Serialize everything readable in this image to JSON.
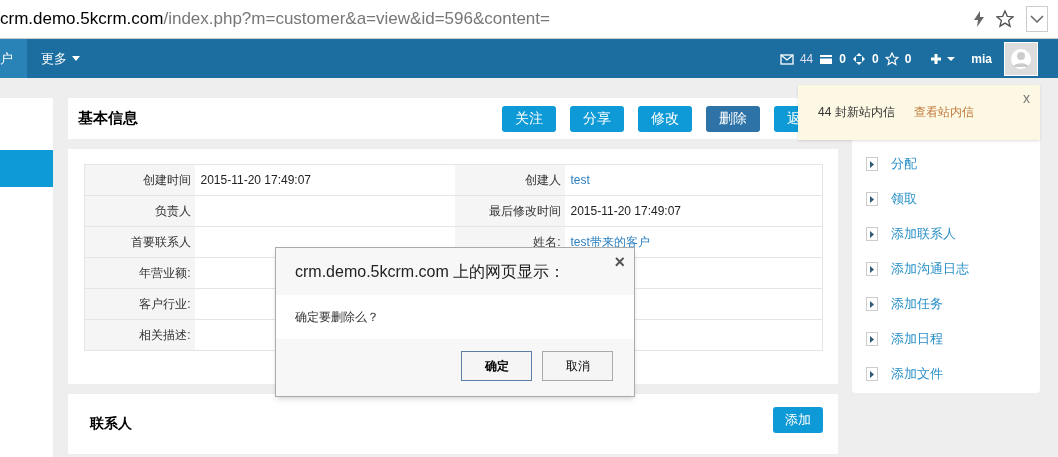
{
  "address_bar": {
    "host": "crm.demo.5kcrm.com",
    "path": "/index.php?m=customer&a=view&id=596&content="
  },
  "navbar": {
    "items": [
      {
        "label": "户",
        "selected": true
      },
      {
        "label": "更多",
        "selected": false
      }
    ],
    "counters": [
      {
        "kind": "mail",
        "value": "44"
      },
      {
        "kind": "card",
        "value": "0"
      },
      {
        "kind": "move",
        "value": "0"
      },
      {
        "kind": "star",
        "value": "0"
      }
    ],
    "user": "mia"
  },
  "basic_info": {
    "title": "基本信息",
    "buttons": [
      {
        "label": "关注",
        "kind": "primary"
      },
      {
        "label": "分享",
        "kind": "primary"
      },
      {
        "label": "修改",
        "kind": "primary"
      },
      {
        "label": "删除",
        "kind": "danger"
      },
      {
        "label": "返",
        "kind": "primary"
      }
    ],
    "rows": [
      {
        "cells": [
          {
            "label": "创建时间",
            "value": "2015-11-20 17:49:07",
            "kind": "text"
          },
          {
            "label": "创建人",
            "value": "test",
            "kind": "link"
          }
        ]
      },
      {
        "cells": [
          {
            "label": "负责人"
          },
          {
            "label": "最后修改时间",
            "value": "2015-11-20 17:49:07",
            "kind": "text"
          }
        ]
      },
      {
        "cells": [
          {
            "label": "首要联系人"
          },
          {
            "label": "姓名:",
            "value": "test带来的客户",
            "kind": "link"
          }
        ]
      },
      {
        "cells": [
          {
            "label": "年营业额:"
          },
          {}
        ]
      },
      {
        "cells": [
          {
            "label": "客户行业:"
          },
          {}
        ]
      },
      {
        "cells": [
          {
            "label": "相关描述:"
          },
          {}
        ]
      }
    ]
  },
  "contacts": {
    "title": "联系人",
    "add_button": "添加"
  },
  "actions": [
    "分配",
    "领取",
    "添加联系人",
    "添加沟通日志",
    "添加任务",
    "添加日程",
    "添加文件"
  ],
  "notification": {
    "text": "44 封新站内信",
    "link": "查看站内信",
    "close": "x"
  },
  "dialog": {
    "title": "crm.demo.5kcrm.com 上的网页显示：",
    "message": "确定要删除么？",
    "close": "×",
    "buttons": [
      "确定",
      "取消"
    ]
  }
}
